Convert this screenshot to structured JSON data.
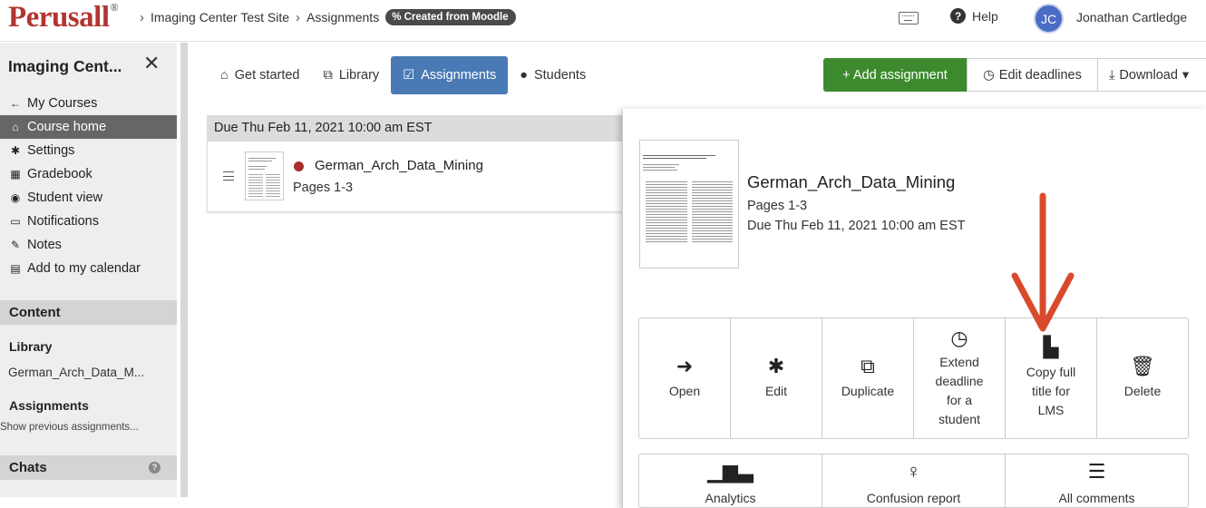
{
  "header": {
    "logo": "Perusall",
    "logo_mark": "®",
    "breadcrumbs": [
      "Imaging Center Test Site",
      "Assignments"
    ],
    "badge": "% Created from Moodle",
    "help": "Help",
    "avatar_initials": "JC",
    "user_name": "Jonathan Cartledge"
  },
  "sidebar": {
    "title": "Imaging Cent...",
    "items": [
      {
        "icon": "arrow-left-icon",
        "label": "My Courses"
      },
      {
        "icon": "home-icon",
        "label": "Course home",
        "active": true
      },
      {
        "icon": "gear-icon",
        "label": "Settings"
      },
      {
        "icon": "table-icon",
        "label": "Gradebook"
      },
      {
        "icon": "eye-icon",
        "label": "Student view"
      },
      {
        "icon": "inbox-icon",
        "label": "Notifications"
      },
      {
        "icon": "pencil-icon",
        "label": "Notes"
      },
      {
        "icon": "calendar-icon",
        "label": "Add to my calendar"
      }
    ],
    "content_heading": "Content",
    "library_heading": "Library",
    "library_item": "German_Arch_Data_M...",
    "assignments_heading": "Assignments",
    "show_previous": "Show previous assignments...",
    "chats_heading": "Chats"
  },
  "tabs": [
    {
      "icon": "home-icon",
      "label": "Get started"
    },
    {
      "icon": "copy-icon",
      "label": "Library"
    },
    {
      "icon": "calendar-check-icon",
      "label": "Assignments",
      "active": true
    },
    {
      "icon": "user-icon",
      "label": "Students"
    }
  ],
  "toolbar": {
    "add_label": "+ Add assignment",
    "deadlines_label": "Edit deadlines",
    "download_label": "Download"
  },
  "assignments": {
    "due_header": "Due Thu Feb 11, 2021 10:00 am EST",
    "row_title": "German_Arch_Data_Mining",
    "row_pages": "Pages 1-3"
  },
  "panel": {
    "title": "German_Arch_Data_Mining",
    "pages": "Pages 1-3",
    "due": "Due Thu Feb 11, 2021 10:00 am EST",
    "actions": [
      {
        "icon": "arrow-right-icon",
        "label": "Open"
      },
      {
        "icon": "gear-icon",
        "label": "Edit"
      },
      {
        "icon": "duplicate-icon",
        "label": "Duplicate"
      },
      {
        "icon": "clock-icon",
        "label": "Extend\ndeadline\nfor a\nstudent"
      },
      {
        "icon": "copy-file-icon",
        "label": "Copy full\ntitle for\nLMS"
      },
      {
        "icon": "trash-icon",
        "label": "Delete"
      }
    ],
    "actions_row2": [
      {
        "icon": "bar-chart-icon",
        "label": "Analytics"
      },
      {
        "icon": "lightbulb-icon",
        "label": "Confusion report"
      },
      {
        "icon": "list-icon",
        "label": "All comments"
      }
    ]
  },
  "colors": {
    "brand": "#b2352f",
    "tab_active": "#4a7ab5",
    "add_button": "#3c8a2d",
    "annotation_arrow": "#d94a2c"
  }
}
